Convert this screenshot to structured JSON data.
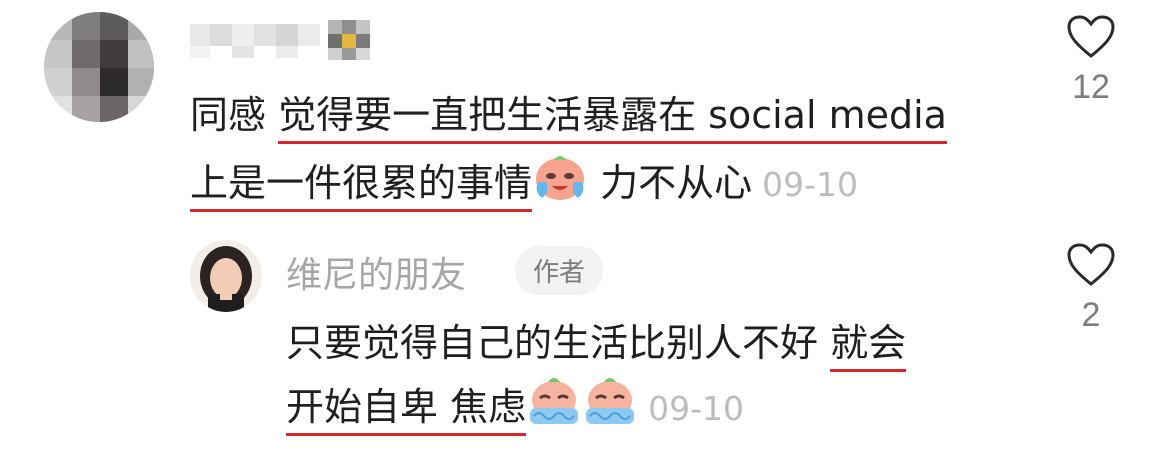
{
  "comments": [
    {
      "author": "",
      "text": {
        "lead": "同感 ",
        "line1": "觉得要一直把生活暴露在 social media",
        "line2": "上是一件很累的事情",
        "emoji": "crying-face-emoji",
        "tail": " 力不从心"
      },
      "date": "09-10",
      "likes": "12"
    },
    {
      "author": "维尼的朋友",
      "badge": "作者",
      "text": {
        "line1_plain": "只要觉得自己的生活比别人不好 ",
        "line1_ul": "就会",
        "line2_ul": "开始自卑 焦虑",
        "emoji": "crying-face-emoji"
      },
      "date": "09-10",
      "likes": "2"
    }
  ],
  "colors": {
    "underline": "#d8262e",
    "muted": "#a6a6a6",
    "date": "#bcbcbc"
  },
  "icons": [
    "heart-outline-icon"
  ]
}
